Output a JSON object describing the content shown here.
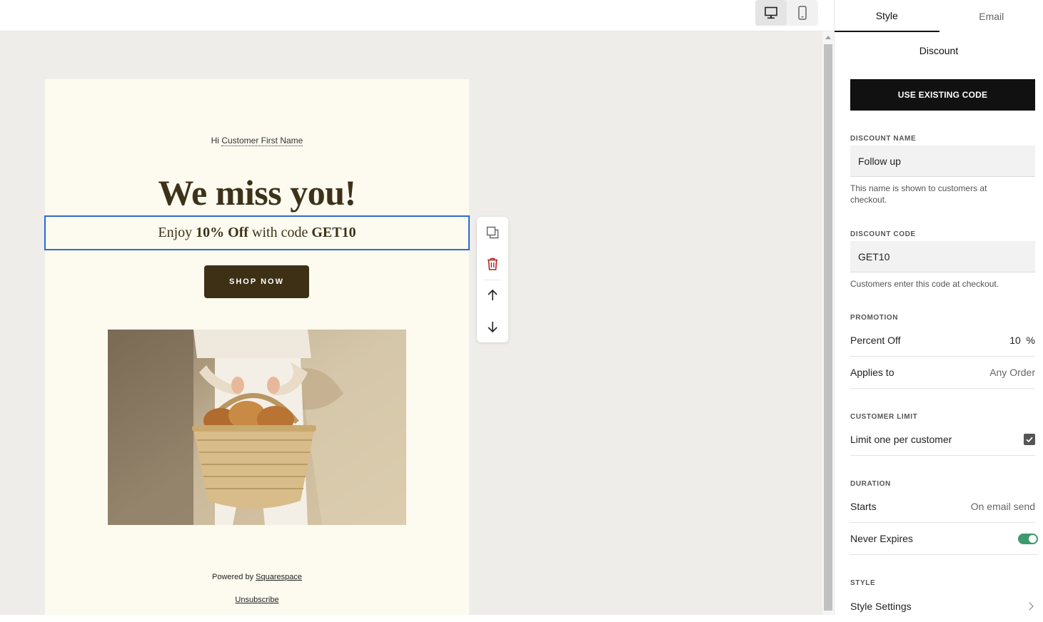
{
  "preview": {
    "device_modes": [
      "desktop",
      "mobile"
    ],
    "active_device": "desktop"
  },
  "email": {
    "greeting_prefix": "Hi",
    "greeting_token": "Customer First Name",
    "headline": "We miss you!",
    "promo_prefix": "Enjoy",
    "promo_amount": "10% Off",
    "promo_middle": "with code",
    "promo_code": "GET10",
    "cta_label": "SHOP NOW",
    "powered_prefix": "Powered by",
    "powered_link": "Squarespace",
    "unsubscribe": "Unsubscribe"
  },
  "block_tools": [
    "duplicate-icon",
    "trash-icon",
    "arrow-up-icon",
    "arrow-down-icon"
  ],
  "panel": {
    "tabs": [
      {
        "label": "Style",
        "active": true
      },
      {
        "label": "Email",
        "active": false
      }
    ],
    "title": "Discount",
    "use_existing_label": "USE EXISTING CODE",
    "discount_name_label": "DISCOUNT NAME",
    "discount_name_value": "Follow up",
    "discount_name_help": "This name is shown to customers at checkout.",
    "discount_code_label": "DISCOUNT CODE",
    "discount_code_value": "GET10",
    "discount_code_help": "Customers enter this code at checkout.",
    "promotion_label": "PROMOTION",
    "percent_off_label": "Percent Off",
    "percent_off_value": "10",
    "percent_unit": "%",
    "applies_to_label": "Applies to",
    "applies_to_value": "Any Order",
    "customer_limit_label": "CUSTOMER LIMIT",
    "limit_one_label": "Limit one per customer",
    "limit_one_checked": true,
    "duration_label": "DURATION",
    "starts_label": "Starts",
    "starts_value": "On email send",
    "never_expires_label": "Never Expires",
    "never_expires_on": true,
    "style_label": "STYLE",
    "style_settings_label": "Style Settings"
  },
  "colors": {
    "accent_blue": "#2c6bd1",
    "cta_brown": "#3d3015",
    "toggle_green": "#3e9a6c",
    "email_bg": "#fdfbf0",
    "delete_red": "#b3261e"
  }
}
